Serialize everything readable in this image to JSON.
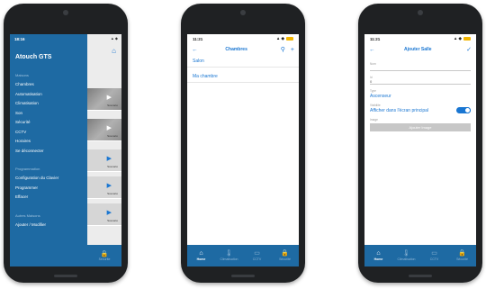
{
  "phone1": {
    "time": "18:16",
    "brand": "Atouch GTS",
    "sections": [
      {
        "title": "Maisons",
        "items": [
          "Chambres",
          "Automatisation",
          "Climatisation",
          "Son",
          "Sécurité",
          "CCTV",
          "Horaires",
          "Se déconnecter"
        ]
      },
      {
        "title": "Programmation",
        "items": [
          "Configuration du Clavier",
          "Programmer",
          "Effacer"
        ]
      },
      {
        "title": "Autres Maisons",
        "items": [
          "Ajouter / Modifier"
        ]
      }
    ],
    "card_labels": [
      "Scenario",
      "Scenario",
      "Scenario",
      "Scenario",
      "Scenario"
    ],
    "bottom_label": "Securite"
  },
  "phone2": {
    "time": "11:21",
    "title": "Chambres",
    "items": [
      "Salon",
      "Ma chambre"
    ]
  },
  "phone3": {
    "time": "11:21",
    "title": "Ajouter Salle",
    "fields": {
      "name_label": "Nom",
      "id_label": "Id",
      "id_value": "0",
      "type_label": "Type",
      "type_value": "Ascenseur",
      "visible_label": "Visibilite",
      "visible_value": "Afficher dans l'écran principal",
      "image_label": "Image",
      "button": "Ajouter Image"
    }
  },
  "tabs": [
    "Home",
    "Climatisation",
    "CCTV",
    "Sécurité"
  ],
  "icons": {
    "home": "home-icon",
    "clim": "thermometer-icon",
    "cctv": "camera-icon",
    "security": "lock-icon",
    "back": "back-arrow-icon",
    "search": "search-icon",
    "add": "plus-icon",
    "check": "check-icon"
  },
  "colors": {
    "accent": "#1976d2",
    "drawer": "#1e6aa3"
  }
}
